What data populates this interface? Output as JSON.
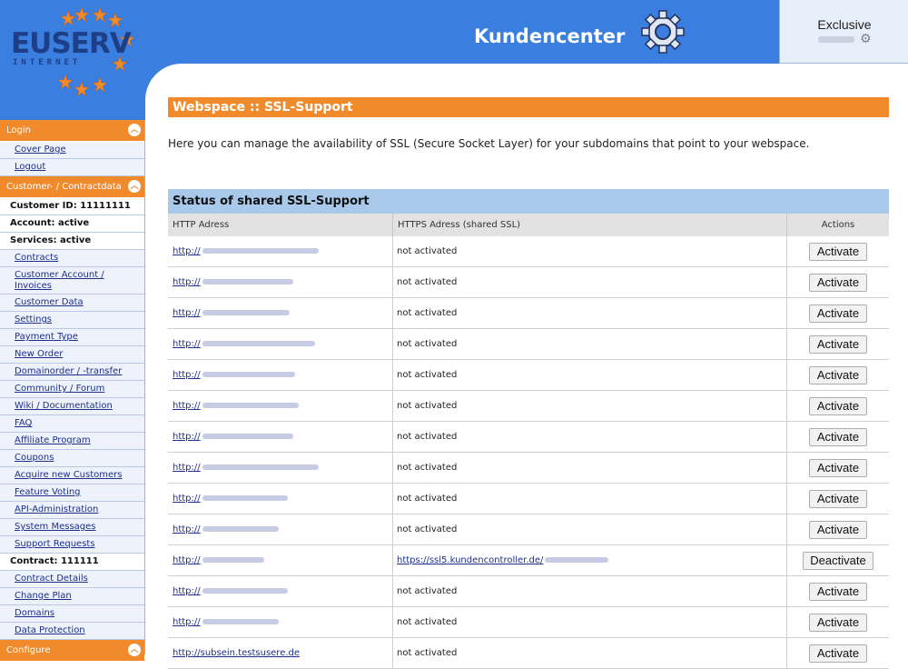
{
  "header": {
    "logo_text": "EUSERV",
    "logo_sub": "INTERNET",
    "title": "Kundencenter",
    "account_label": "Exclusive",
    "brand_color": "#3a7fe0",
    "accent_color": "#f18a2b"
  },
  "sidebar": {
    "login_head": "Login",
    "login_items": [
      "Cover Page",
      "Logout"
    ],
    "customer_head": "Customer- / Contractdata",
    "customer_id": "Customer ID: 11111111",
    "account_status": "Account: active",
    "services_status": "Services: active",
    "contracts": "Contracts",
    "customer_account_line1": "Customer Account /",
    "customer_account_line2": "Invoices",
    "items": [
      "Customer Data",
      "Settings",
      "Payment Type",
      "New Order",
      "Domainorder / -transfer",
      "Community / Forum",
      "Wiki / Documentation",
      "FAQ",
      "Affiliate Program",
      "Coupons",
      "Acquire new Customers",
      "Feature Voting",
      "API-Administration",
      "System Messages",
      "Support Requests"
    ],
    "contract": "Contract: 111111",
    "contract_items": [
      "Contract Details",
      "Change Plan",
      "Domains",
      "Data Protection"
    ],
    "configure_head": "Configure"
  },
  "main": {
    "page_title": "Webspace :: SSL-Support",
    "intro": "Here you can manage the availability of SSL (Secure Socket Layer) for your subdomains that point to your webspace.",
    "table_title": "Status of shared SSL-Support",
    "col_http": "HTTP Adress",
    "col_https": "HTTPS Adress (shared SSL)",
    "col_actions": "Actions",
    "rows": [
      {
        "http": "http://",
        "https": "not activated",
        "action": "Activate"
      },
      {
        "http": "http://",
        "https": "not activated",
        "action": "Activate"
      },
      {
        "http": "http://",
        "https": "not activated",
        "action": "Activate"
      },
      {
        "http": "http://",
        "https": "not activated",
        "action": "Activate"
      },
      {
        "http": "http://",
        "https": "not activated",
        "action": "Activate"
      },
      {
        "http": "http://",
        "https": "not activated",
        "action": "Activate"
      },
      {
        "http": "http://",
        "https": "not activated",
        "action": "Activate"
      },
      {
        "http": "http://",
        "https": "not activated",
        "action": "Activate"
      },
      {
        "http": "http://",
        "https": "not activated",
        "action": "Activate"
      },
      {
        "http": "http://",
        "https": "not activated",
        "action": "Activate"
      },
      {
        "http": "http://",
        "https": "https://ssl5.kundencontroller.de/",
        "action": "Deactivate"
      },
      {
        "http": "http://",
        "https": "not activated",
        "action": "Activate"
      },
      {
        "http": "http://",
        "https": "not activated",
        "action": "Activate"
      },
      {
        "http": "http://subsein.testsusere.de",
        "https": "not activated",
        "action": "Activate"
      }
    ]
  }
}
